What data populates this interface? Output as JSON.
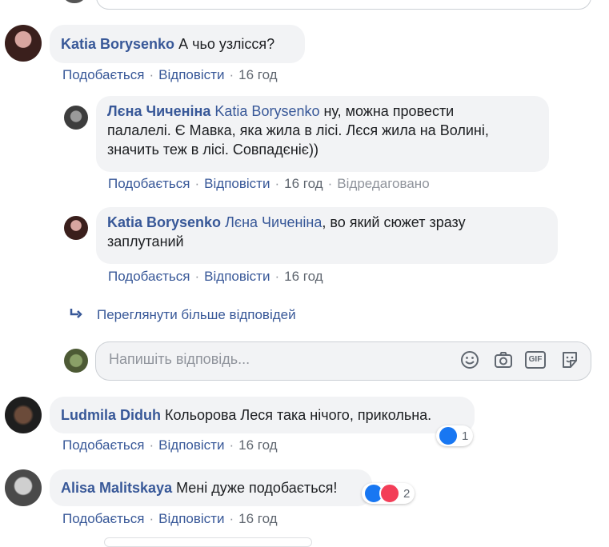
{
  "comments": [
    {
      "author": "Katia Borysenko",
      "text": "А чьо узлісся?",
      "actions": {
        "like": "Подобається",
        "reply": "Відповісти",
        "time": "16 год"
      }
    },
    {
      "author": "Ludmila Diduh",
      "text": "Кольорова Леся така нічого, прикольна.",
      "actions": {
        "like": "Подобається",
        "reply": "Відповісти",
        "time": "16 год"
      },
      "reactions": {
        "count": "1",
        "icons": [
          "like-icon"
        ]
      }
    },
    {
      "author": "Alisa Malitskaya",
      "text": "Мені дуже подобається!",
      "actions": {
        "like": "Подобається",
        "reply": "Відповісти",
        "time": "16 год"
      },
      "reactions": {
        "count": "2",
        "icons": [
          "like-icon",
          "love-icon"
        ]
      }
    }
  ],
  "replies": [
    {
      "author": "Лєна Чиченіна",
      "mention": "Katia Borysenko",
      "line1": " ну, можна провести",
      "line2": "палалелі. Є Мавка, яка жила в лісі. Лєся жила на Волині,",
      "line3": "значить теж в лісі. Совпадєніє))",
      "actions": {
        "like": "Подобається",
        "reply": "Відповісти",
        "time": "16 год",
        "edited": "Відредаговано"
      }
    },
    {
      "author": "Katia Borysenko",
      "mention": "Лєна Чиченіна",
      "line1": ", во який сюжет зразу",
      "line2": "заплутаний",
      "actions": {
        "like": "Подобається",
        "reply": "Відповісти",
        "time": "16 год"
      }
    }
  ],
  "more_replies": {
    "label": "Переглянути більше відповідей",
    "icon": "reply-arrow-icon"
  },
  "reply_input": {
    "placeholder": "Напишіть відповідь...",
    "icons": [
      "emoji-icon",
      "camera-icon",
      "gif-icon",
      "sticker-icon"
    ],
    "gif_label": "GIF"
  },
  "separator": "·",
  "colors": {
    "link": "#385898",
    "bubble": "#f2f3f5",
    "like": "#1877f2",
    "love": "#f33e58"
  }
}
